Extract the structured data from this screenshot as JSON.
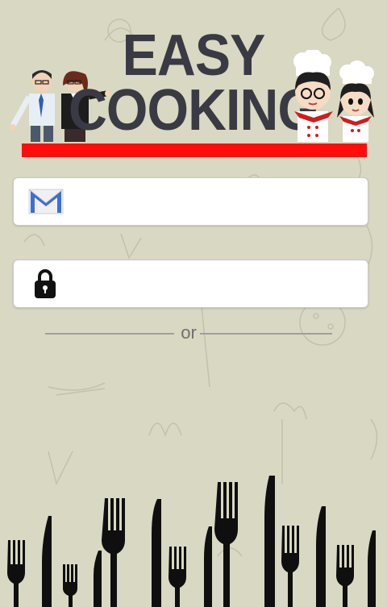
{
  "app": {
    "title_line1": "EASY",
    "title_line2": "COOKING"
  },
  "login": {
    "email_icon": "gmail-envelope-icon",
    "email_value": "",
    "password_icon": "padlock-icon",
    "password_value": "",
    "divider_text": "or"
  },
  "colors": {
    "background": "#d9d8c3",
    "title": "#3a3a44",
    "accent_bar": "#ff0d0d"
  }
}
